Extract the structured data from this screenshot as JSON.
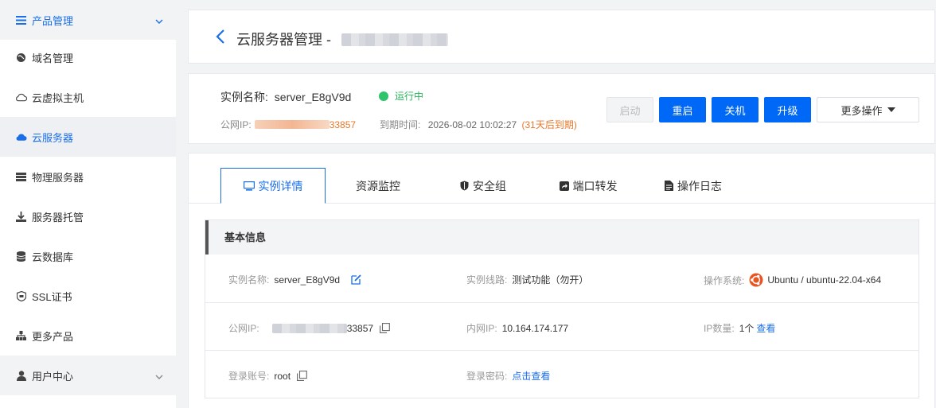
{
  "sidebar": {
    "group_product": "产品管理",
    "items": [
      {
        "label": "域名管理"
      },
      {
        "label": "云虚拟主机"
      },
      {
        "label": "云服务器"
      },
      {
        "label": "物理服务器"
      },
      {
        "label": "服务器托管"
      },
      {
        "label": "云数据库"
      },
      {
        "label": "SSL证书"
      },
      {
        "label": "更多产品"
      }
    ],
    "group_user": "用户中心"
  },
  "header": {
    "title": "云服务器管理 -"
  },
  "instance": {
    "name_label": "实例名称:",
    "name": "server_E8gV9d",
    "status": "运行中",
    "ip_label": "公网IP:",
    "ip_suffix": "33857",
    "expire_label": "到期时间:",
    "expire_time": "2026-08-02 10:02:27",
    "expire_note": "(31天后到期)"
  },
  "actions": {
    "start": "启动",
    "restart": "重启",
    "shutdown": "关机",
    "upgrade": "升级",
    "more": "更多操作"
  },
  "tabs": [
    {
      "label": "实例详情"
    },
    {
      "label": "资源监控"
    },
    {
      "label": "安全组"
    },
    {
      "label": "端口转发"
    },
    {
      "label": "操作日志"
    }
  ],
  "basic": {
    "title": "基本信息",
    "name_label": "实例名称:",
    "name": "server_E8gV9d",
    "line_label": "实例线路:",
    "line": "测试功能（勿开）",
    "os_label": "操作系统:",
    "os": "Ubuntu / ubuntu-22.04-x64",
    "public_ip_label": "公网IP:",
    "public_ip_suffix": "33857",
    "private_ip_label": "内网IP:",
    "private_ip": "10.164.174.177",
    "ip_count_label": "IP数量:",
    "ip_count": "1个",
    "ip_count_link": "查看",
    "account_label": "登录账号:",
    "account": "root",
    "password_label": "登录密码:",
    "password_link": "点击查看"
  },
  "colors": {
    "primary": "#0068f7",
    "link": "#1a6eea",
    "running": "#2fc46c",
    "warning": "#e8792b"
  }
}
